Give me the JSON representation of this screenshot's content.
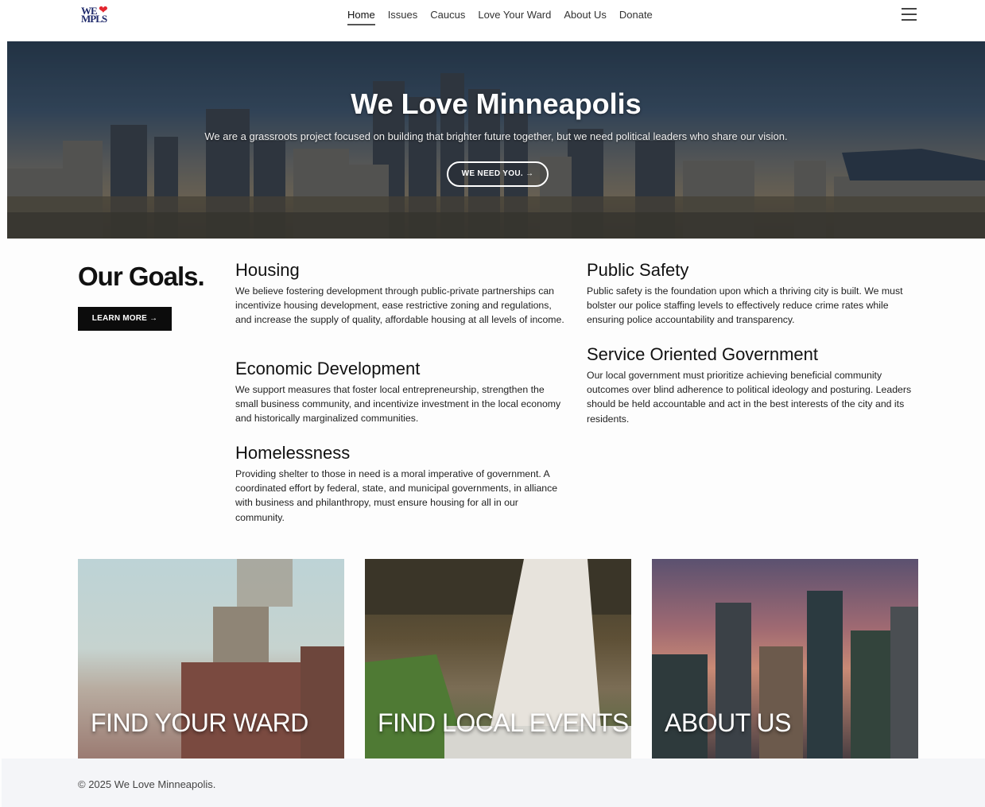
{
  "nav": {
    "logo_line1": "WE",
    "logo_line2": "MPLS",
    "links": [
      {
        "label": "Home",
        "active": true
      },
      {
        "label": "Issues"
      },
      {
        "label": "Caucus"
      },
      {
        "label": "Love Your Ward"
      },
      {
        "label": "About Us"
      },
      {
        "label": "Donate"
      }
    ],
    "menu_icon": "hamburger-icon"
  },
  "hero": {
    "title": "We Love Minneapolis",
    "subtitle": "We are a grassroots project focused on building that brighter future together, but we need political leaders who share our vision.",
    "button_label": "WE NEED YOU. →"
  },
  "goals": {
    "title": "Our Goals.",
    "learn_more": "LEARN MORE →",
    "items": [
      {
        "title": "Housing",
        "text": "We believe fostering development through public-private partnerships can incentivize housing development, ease restrictive zoning and regulations, and increase the supply of quality, affordable housing at all levels of income."
      },
      {
        "title": "Economic Development",
        "text": "We support measures that foster local entrepreneurship, strengthen the small business community, and incentivize investment in the local economy and historically marginalized communities."
      },
      {
        "title": "Homelessness",
        "text": "Providing shelter to those in need is a moral imperative of government. A coordinated effort by federal, state, and municipal governments, in alliance with business and philanthropy, must ensure housing for all in our community."
      },
      {
        "title": "Public Safety",
        "text": "Public safety is the foundation upon which a thriving city is built. We must bolster our police staffing levels to effectively reduce crime rates while ensuring police accountability and transparency."
      },
      {
        "title": "Service Oriented Government",
        "text": "Our local government must prioritize achieving beneficial community outcomes over blind adherence to political ideology and posturing. Leaders should be held accountable and act in the best interests of the city and its residents."
      }
    ]
  },
  "cards": [
    {
      "label": "FIND YOUR WARD"
    },
    {
      "label": "FIND LOCAL EVENTS"
    },
    {
      "label": "ABOUT US"
    }
  ],
  "footer": {
    "text": "© 2025 We Love Minneapolis."
  },
  "colors": {
    "logo_blue": "#1f2a6b",
    "logo_heart": "#e3262f",
    "button_black": "#0c0c0c"
  }
}
